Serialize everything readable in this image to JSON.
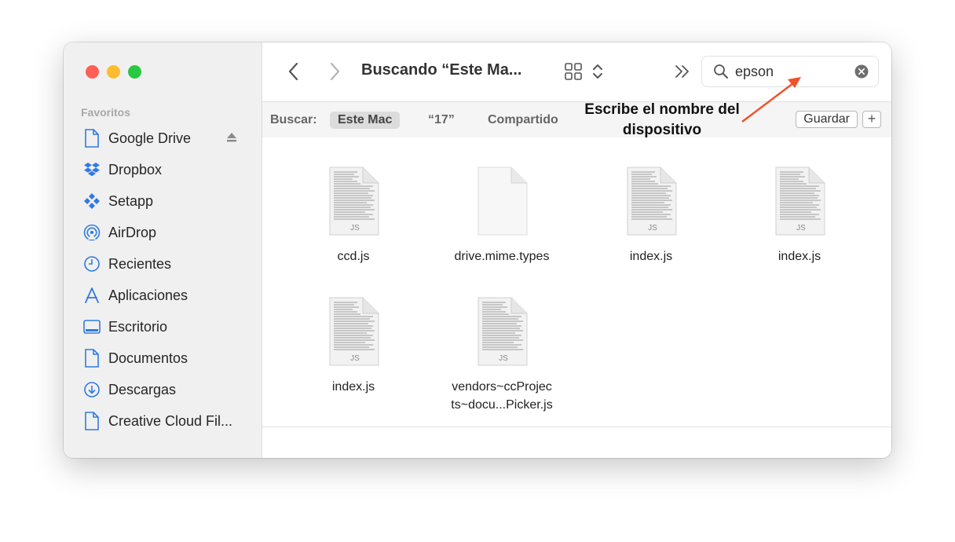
{
  "sidebar": {
    "section_title": "Favoritos",
    "items": [
      {
        "label": "Google Drive",
        "icon": "document-icon"
      },
      {
        "label": "Dropbox",
        "icon": "dropbox-icon"
      },
      {
        "label": "Setapp",
        "icon": "setapp-icon"
      },
      {
        "label": "AirDrop",
        "icon": "airdrop-icon"
      },
      {
        "label": "Recientes",
        "icon": "clock-icon"
      },
      {
        "label": "Aplicaciones",
        "icon": "applications-icon"
      },
      {
        "label": "Escritorio",
        "icon": "desktop-icon"
      },
      {
        "label": "Documentos",
        "icon": "document-icon"
      },
      {
        "label": "Descargas",
        "icon": "download-icon"
      },
      {
        "label": "Creative Cloud Fil...",
        "icon": "document-icon"
      }
    ]
  },
  "toolbar": {
    "title": "Buscando “Este Ma...",
    "search_value": "epson"
  },
  "scope": {
    "label": "Buscar:",
    "options": [
      "Este Mac",
      "“17”",
      "Compartido"
    ],
    "selected": "Este Mac",
    "save_label": "Guardar",
    "plus_label": "+"
  },
  "files": [
    {
      "name": "ccd.js",
      "kind": "JS"
    },
    {
      "name": "drive.mime.types",
      "kind": ""
    },
    {
      "name": "index.js",
      "kind": "JS"
    },
    {
      "name": "index.js",
      "kind": "JS"
    },
    {
      "name": "index.js",
      "kind": "JS"
    },
    {
      "name": "vendors~ccProjec\nts~docu...Picker.js",
      "kind": "JS"
    }
  ],
  "annotation": {
    "text": "Escribe el nombre del dispositivo",
    "arrow_color": "#f0502c"
  },
  "colors": {
    "close": "#fe5f57",
    "minimize": "#febc2e",
    "zoom": "#28c840",
    "sidebar_icon": "#2f7ae5"
  }
}
